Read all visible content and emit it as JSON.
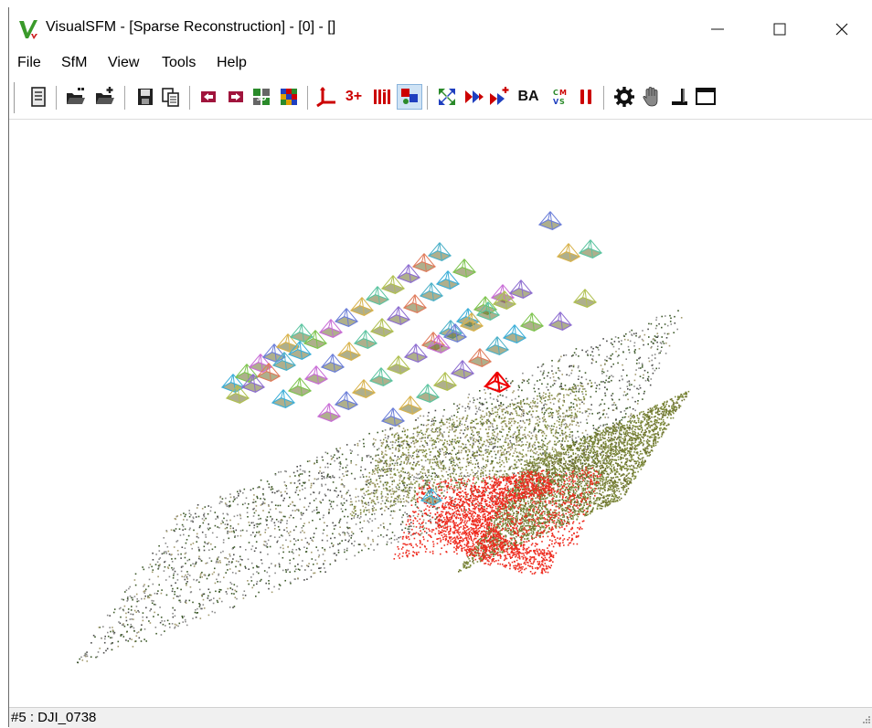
{
  "window": {
    "title": "VisualSFM - [Sparse Reconstruction] - [0] - []",
    "icon": "visualsfm-logo-icon",
    "controls": [
      "minimize-icon",
      "maximize-icon",
      "close-icon"
    ]
  },
  "menu": {
    "items": [
      {
        "label": "File"
      },
      {
        "label": "SfM"
      },
      {
        "label": "View"
      },
      {
        "label": "Tools"
      },
      {
        "label": "Help"
      }
    ]
  },
  "toolbar": {
    "text_buttons": {
      "three_plus": "3+",
      "ba": "BA"
    },
    "icons": [
      "log-window-icon",
      "open-multi-images-icon",
      "open-add-images-icon",
      "save-nvm-icon",
      "copy-icon",
      "previous-icon",
      "next-icon",
      "compute-matches-icon",
      "match-matrix-icon",
      "coordinate-axes-icon",
      "three-plus-text",
      "feature-bars-icon",
      "toggle-view-icon",
      "compute-missing-match-icon",
      "reconstruct-sparse-icon",
      "reconstruct-resume-icon",
      "bundle-adjust-text",
      "dense-cmvs-icon",
      "pause-icon",
      "settings-gear-icon",
      "hand-pan-icon",
      "ground-control-icon",
      "fullscreen-window-icon"
    ],
    "colors": {
      "red": "#cc0000",
      "blue": "#1f3fbf",
      "green": "#2a8a2a"
    }
  },
  "status": {
    "text": "#5 : DJI_0738"
  },
  "viewport": {
    "background": "#ffffff",
    "point_colors": [
      "#7d8a3a",
      "#6b6e2e",
      "#ee2b1f",
      "#3d5a2a",
      "#8a8a8a",
      "#4a4a4a",
      "#a39b6e"
    ],
    "selected_camera_color": "#ee0000"
  }
}
